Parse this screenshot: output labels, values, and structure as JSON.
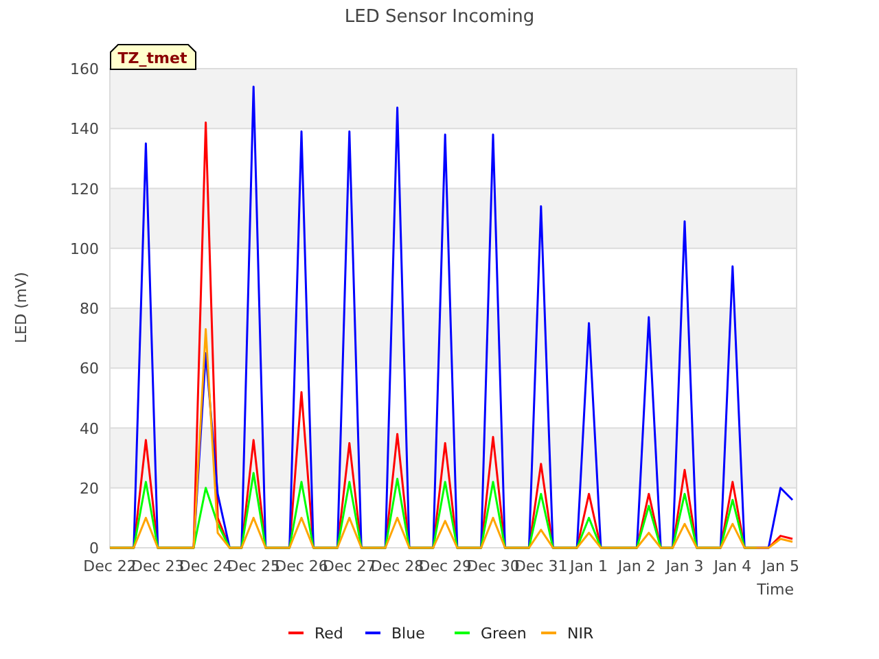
{
  "title": "LED Sensor Incoming",
  "badge": "TZ_tmet",
  "chart_data": {
    "type": "line",
    "xlabel": "Time",
    "ylabel": "LED (mV)",
    "categories": [
      "Dec 22",
      null,
      null,
      null,
      "Dec 23",
      null,
      null,
      null,
      "Dec 24",
      null,
      null,
      null,
      "Dec 25",
      null,
      null,
      null,
      "Dec 26",
      null,
      null,
      null,
      "Dec 27",
      null,
      null,
      null,
      "Dec 28",
      null,
      null,
      null,
      "Dec 29",
      null,
      null,
      null,
      "Dec 30",
      null,
      null,
      null,
      "Dec 31",
      null,
      null,
      null,
      "Jan 1",
      null,
      null,
      null,
      "Jan 2",
      null,
      null,
      null,
      "Jan 3",
      null,
      null,
      null,
      "Jan 4",
      null,
      null,
      null,
      "Jan 5",
      null
    ],
    "series": [
      {
        "name": "Red",
        "color": "#ff0000",
        "values": [
          0,
          0,
          0,
          36,
          0,
          0,
          0,
          0,
          142,
          10,
          0,
          0,
          36,
          0,
          0,
          0,
          52,
          0,
          0,
          0,
          35,
          0,
          0,
          0,
          38,
          0,
          0,
          0,
          35,
          0,
          0,
          0,
          37,
          0,
          0,
          0,
          28,
          0,
          0,
          0,
          18,
          0,
          0,
          0,
          0,
          18,
          0,
          0,
          26,
          0,
          0,
          0,
          22,
          0,
          0,
          0,
          4,
          3
        ]
      },
      {
        "name": "Blue",
        "color": "#0000ff",
        "values": [
          0,
          0,
          0,
          135,
          0,
          0,
          0,
          0,
          65,
          18,
          0,
          0,
          154,
          0,
          0,
          0,
          139,
          0,
          0,
          0,
          139,
          0,
          0,
          0,
          147,
          0,
          0,
          0,
          138,
          0,
          0,
          0,
          138,
          0,
          0,
          0,
          114,
          0,
          0,
          0,
          75,
          0,
          0,
          0,
          0,
          77,
          0,
          0,
          109,
          0,
          0,
          0,
          94,
          0,
          0,
          0,
          20,
          16
        ]
      },
      {
        "name": "Green",
        "color": "#00ff00",
        "values": [
          0,
          0,
          0,
          22,
          0,
          0,
          0,
          0,
          20,
          8,
          0,
          0,
          25,
          0,
          0,
          0,
          22,
          0,
          0,
          0,
          22,
          0,
          0,
          0,
          23,
          0,
          0,
          0,
          22,
          0,
          0,
          0,
          22,
          0,
          0,
          0,
          18,
          0,
          0,
          0,
          10,
          0,
          0,
          0,
          0,
          14,
          0,
          0,
          18,
          0,
          0,
          0,
          16,
          0,
          0,
          null,
          null,
          null
        ]
      },
      {
        "name": "NIR",
        "color": "#ffa500",
        "values": [
          0,
          0,
          0,
          10,
          0,
          0,
          0,
          0,
          73,
          5,
          0,
          0,
          10,
          0,
          0,
          0,
          10,
          0,
          0,
          0,
          10,
          0,
          0,
          0,
          10,
          0,
          0,
          0,
          9,
          0,
          0,
          0,
          10,
          0,
          0,
          0,
          6,
          0,
          0,
          0,
          5,
          0,
          0,
          0,
          0,
          5,
          0,
          0,
          8,
          0,
          0,
          0,
          8,
          0,
          0,
          0,
          3,
          2
        ]
      }
    ],
    "grid": true,
    "legend": true,
    "ylim": [
      0,
      160
    ],
    "yticks": [
      0,
      20,
      40,
      60,
      80,
      100,
      120,
      140,
      160
    ]
  }
}
